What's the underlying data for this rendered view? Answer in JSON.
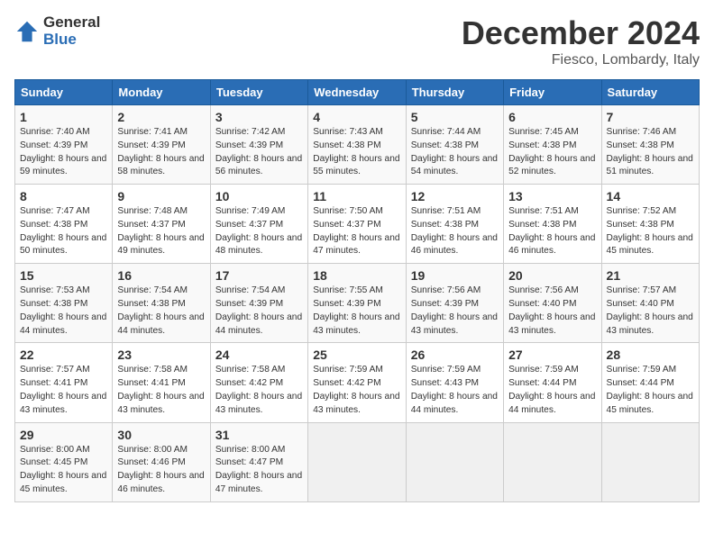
{
  "header": {
    "logo_general": "General",
    "logo_blue": "Blue",
    "title": "December 2024",
    "subtitle": "Fiesco, Lombardy, Italy"
  },
  "days_of_week": [
    "Sunday",
    "Monday",
    "Tuesday",
    "Wednesday",
    "Thursday",
    "Friday",
    "Saturday"
  ],
  "weeks": [
    [
      {
        "day": 1,
        "sunrise": "Sunrise: 7:40 AM",
        "sunset": "Sunset: 4:39 PM",
        "daylight": "Daylight: 8 hours and 59 minutes."
      },
      {
        "day": 2,
        "sunrise": "Sunrise: 7:41 AM",
        "sunset": "Sunset: 4:39 PM",
        "daylight": "Daylight: 8 hours and 58 minutes."
      },
      {
        "day": 3,
        "sunrise": "Sunrise: 7:42 AM",
        "sunset": "Sunset: 4:39 PM",
        "daylight": "Daylight: 8 hours and 56 minutes."
      },
      {
        "day": 4,
        "sunrise": "Sunrise: 7:43 AM",
        "sunset": "Sunset: 4:38 PM",
        "daylight": "Daylight: 8 hours and 55 minutes."
      },
      {
        "day": 5,
        "sunrise": "Sunrise: 7:44 AM",
        "sunset": "Sunset: 4:38 PM",
        "daylight": "Daylight: 8 hours and 54 minutes."
      },
      {
        "day": 6,
        "sunrise": "Sunrise: 7:45 AM",
        "sunset": "Sunset: 4:38 PM",
        "daylight": "Daylight: 8 hours and 52 minutes."
      },
      {
        "day": 7,
        "sunrise": "Sunrise: 7:46 AM",
        "sunset": "Sunset: 4:38 PM",
        "daylight": "Daylight: 8 hours and 51 minutes."
      }
    ],
    [
      {
        "day": 8,
        "sunrise": "Sunrise: 7:47 AM",
        "sunset": "Sunset: 4:38 PM",
        "daylight": "Daylight: 8 hours and 50 minutes."
      },
      {
        "day": 9,
        "sunrise": "Sunrise: 7:48 AM",
        "sunset": "Sunset: 4:37 PM",
        "daylight": "Daylight: 8 hours and 49 minutes."
      },
      {
        "day": 10,
        "sunrise": "Sunrise: 7:49 AM",
        "sunset": "Sunset: 4:37 PM",
        "daylight": "Daylight: 8 hours and 48 minutes."
      },
      {
        "day": 11,
        "sunrise": "Sunrise: 7:50 AM",
        "sunset": "Sunset: 4:37 PM",
        "daylight": "Daylight: 8 hours and 47 minutes."
      },
      {
        "day": 12,
        "sunrise": "Sunrise: 7:51 AM",
        "sunset": "Sunset: 4:38 PM",
        "daylight": "Daylight: 8 hours and 46 minutes."
      },
      {
        "day": 13,
        "sunrise": "Sunrise: 7:51 AM",
        "sunset": "Sunset: 4:38 PM",
        "daylight": "Daylight: 8 hours and 46 minutes."
      },
      {
        "day": 14,
        "sunrise": "Sunrise: 7:52 AM",
        "sunset": "Sunset: 4:38 PM",
        "daylight": "Daylight: 8 hours and 45 minutes."
      }
    ],
    [
      {
        "day": 15,
        "sunrise": "Sunrise: 7:53 AM",
        "sunset": "Sunset: 4:38 PM",
        "daylight": "Daylight: 8 hours and 44 minutes."
      },
      {
        "day": 16,
        "sunrise": "Sunrise: 7:54 AM",
        "sunset": "Sunset: 4:38 PM",
        "daylight": "Daylight: 8 hours and 44 minutes."
      },
      {
        "day": 17,
        "sunrise": "Sunrise: 7:54 AM",
        "sunset": "Sunset: 4:39 PM",
        "daylight": "Daylight: 8 hours and 44 minutes."
      },
      {
        "day": 18,
        "sunrise": "Sunrise: 7:55 AM",
        "sunset": "Sunset: 4:39 PM",
        "daylight": "Daylight: 8 hours and 43 minutes."
      },
      {
        "day": 19,
        "sunrise": "Sunrise: 7:56 AM",
        "sunset": "Sunset: 4:39 PM",
        "daylight": "Daylight: 8 hours and 43 minutes."
      },
      {
        "day": 20,
        "sunrise": "Sunrise: 7:56 AM",
        "sunset": "Sunset: 4:40 PM",
        "daylight": "Daylight: 8 hours and 43 minutes."
      },
      {
        "day": 21,
        "sunrise": "Sunrise: 7:57 AM",
        "sunset": "Sunset: 4:40 PM",
        "daylight": "Daylight: 8 hours and 43 minutes."
      }
    ],
    [
      {
        "day": 22,
        "sunrise": "Sunrise: 7:57 AM",
        "sunset": "Sunset: 4:41 PM",
        "daylight": "Daylight: 8 hours and 43 minutes."
      },
      {
        "day": 23,
        "sunrise": "Sunrise: 7:58 AM",
        "sunset": "Sunset: 4:41 PM",
        "daylight": "Daylight: 8 hours and 43 minutes."
      },
      {
        "day": 24,
        "sunrise": "Sunrise: 7:58 AM",
        "sunset": "Sunset: 4:42 PM",
        "daylight": "Daylight: 8 hours and 43 minutes."
      },
      {
        "day": 25,
        "sunrise": "Sunrise: 7:59 AM",
        "sunset": "Sunset: 4:42 PM",
        "daylight": "Daylight: 8 hours and 43 minutes."
      },
      {
        "day": 26,
        "sunrise": "Sunrise: 7:59 AM",
        "sunset": "Sunset: 4:43 PM",
        "daylight": "Daylight: 8 hours and 44 minutes."
      },
      {
        "day": 27,
        "sunrise": "Sunrise: 7:59 AM",
        "sunset": "Sunset: 4:44 PM",
        "daylight": "Daylight: 8 hours and 44 minutes."
      },
      {
        "day": 28,
        "sunrise": "Sunrise: 7:59 AM",
        "sunset": "Sunset: 4:44 PM",
        "daylight": "Daylight: 8 hours and 45 minutes."
      }
    ],
    [
      {
        "day": 29,
        "sunrise": "Sunrise: 8:00 AM",
        "sunset": "Sunset: 4:45 PM",
        "daylight": "Daylight: 8 hours and 45 minutes."
      },
      {
        "day": 30,
        "sunrise": "Sunrise: 8:00 AM",
        "sunset": "Sunset: 4:46 PM",
        "daylight": "Daylight: 8 hours and 46 minutes."
      },
      {
        "day": 31,
        "sunrise": "Sunrise: 8:00 AM",
        "sunset": "Sunset: 4:47 PM",
        "daylight": "Daylight: 8 hours and 47 minutes."
      },
      null,
      null,
      null,
      null
    ]
  ]
}
